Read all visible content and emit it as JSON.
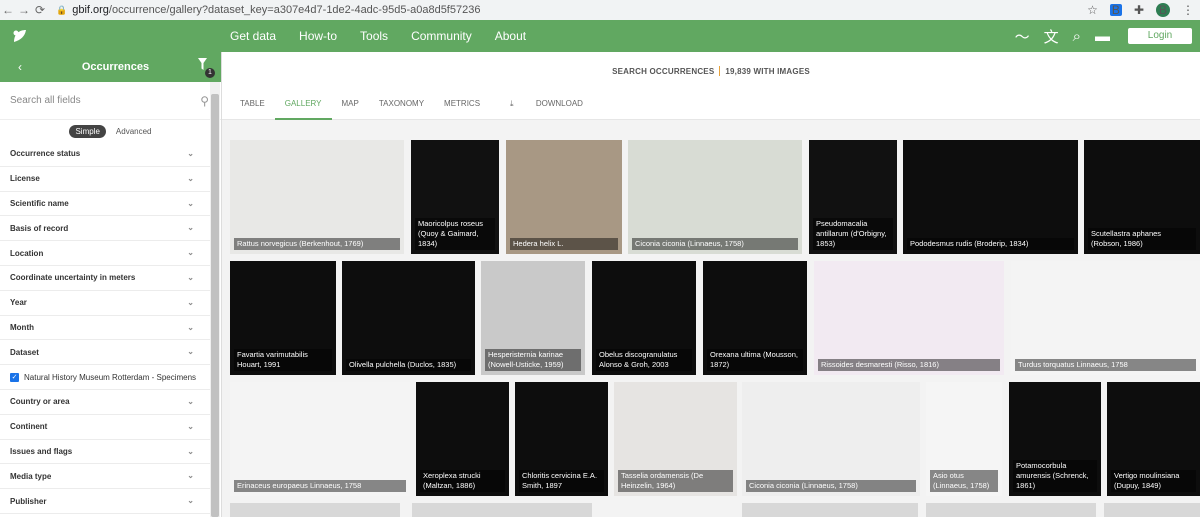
{
  "browser": {
    "url_host": "gbif.org",
    "url_path": "/occurrence/gallery?dataset_key=a307e4d7-1de2-4adc-95d5-a0a8d5f57236",
    "avatar_letter": "B",
    "ext_letter": "B"
  },
  "topnav": {
    "menu": [
      "Get data",
      "How-to",
      "Tools",
      "Community",
      "About"
    ],
    "login_label": "Login"
  },
  "sidebar": {
    "title": "Occurrences",
    "filter_count": "1",
    "search_placeholder": "Search all fields",
    "modes": {
      "simple": "Simple",
      "advanced": "Advanced"
    },
    "filters": [
      "Occurrence status",
      "License",
      "Scientific name",
      "Basis of record",
      "Location",
      "Coordinate uncertainty in meters",
      "Year",
      "Month",
      "Dataset",
      "Country or area",
      "Continent",
      "Issues and flags",
      "Media type",
      "Publisher"
    ],
    "dataset_selected": "Natural History Museum Rotterdam - Specimens"
  },
  "main": {
    "search_label": "SEARCH OCCURRENCES",
    "images_label": "19,839 WITH IMAGES",
    "tabs": [
      "TABLE",
      "GALLERY",
      "MAP",
      "TAXONOMY",
      "METRICS",
      "DOWNLOAD"
    ],
    "active_tab": "GALLERY"
  },
  "gallery": [
    {
      "cap": "Rattus norvegicus (Berkenhout, 1769)",
      "bg": "#e8e8e6"
    },
    {
      "cap": "Maoricolpus roseus (Quoy & Gaimard, 1834)",
      "bg": "#111111"
    },
    {
      "cap": "Hedera helix L.",
      "bg": "#a89884"
    },
    {
      "cap": "Ciconia ciconia (Linnaeus, 1758)",
      "bg": "#d8dcd4"
    },
    {
      "cap": "Pseudomacalia antillarum (d'Orbigny, 1853)",
      "bg": "#111111"
    },
    {
      "cap": "Pododesmus rudis (Broderip, 1834)",
      "bg": "#0d0d0d"
    },
    {
      "cap": "Scutellastra aphanes (Robson, 1986)",
      "bg": "#0d0d0d"
    },
    {
      "cap": "Favartia varimutabilis Houart, 1991",
      "bg": "#0d0d0d"
    },
    {
      "cap": "Olivella pulchella (Duclos, 1835)",
      "bg": "#0d0d0d"
    },
    {
      "cap": "Hesperisternia karinae (Nowell-Usticke, 1959)",
      "bg": "#c9c9c9"
    },
    {
      "cap": "Obelus discogranulatus Alonso & Groh, 2003",
      "bg": "#0d0d0d"
    },
    {
      "cap": "Orexana ultima (Mousson, 1872)",
      "bg": "#0d0d0d"
    },
    {
      "cap": "Rissoides desmaresti (Risso, 1816)",
      "bg": "#f2eaf2"
    },
    {
      "cap": "Turdus torquatus Linnaeus, 1758",
      "bg": "#f4f4f4"
    },
    {
      "cap": "Erinaceus europaeus Linnaeus, 1758",
      "bg": "#f4f4f4"
    },
    {
      "cap": "Xeroplexa strucki (Maltzan, 1886)",
      "bg": "#0d0d0d"
    },
    {
      "cap": "Chloritis cervicina E.A. Smith, 1897",
      "bg": "#0d0d0d"
    },
    {
      "cap": "Tasselia ordamensis (De Heinzelin, 1964)",
      "bg": "#e6e4e2"
    },
    {
      "cap": "Ciconia ciconia (Linnaeus, 1758)",
      "bg": "#eeeeee"
    },
    {
      "cap": "Asio otus (Linnaeus, 1758)",
      "bg": "#f5f5f5"
    },
    {
      "cap": "Potamocorbula amurensis (Schrenck, 1861)",
      "bg": "#0d0d0d"
    },
    {
      "cap": "Vertigo moulinsiana (Dupuy, 1849)",
      "bg": "#0d0d0d"
    }
  ]
}
